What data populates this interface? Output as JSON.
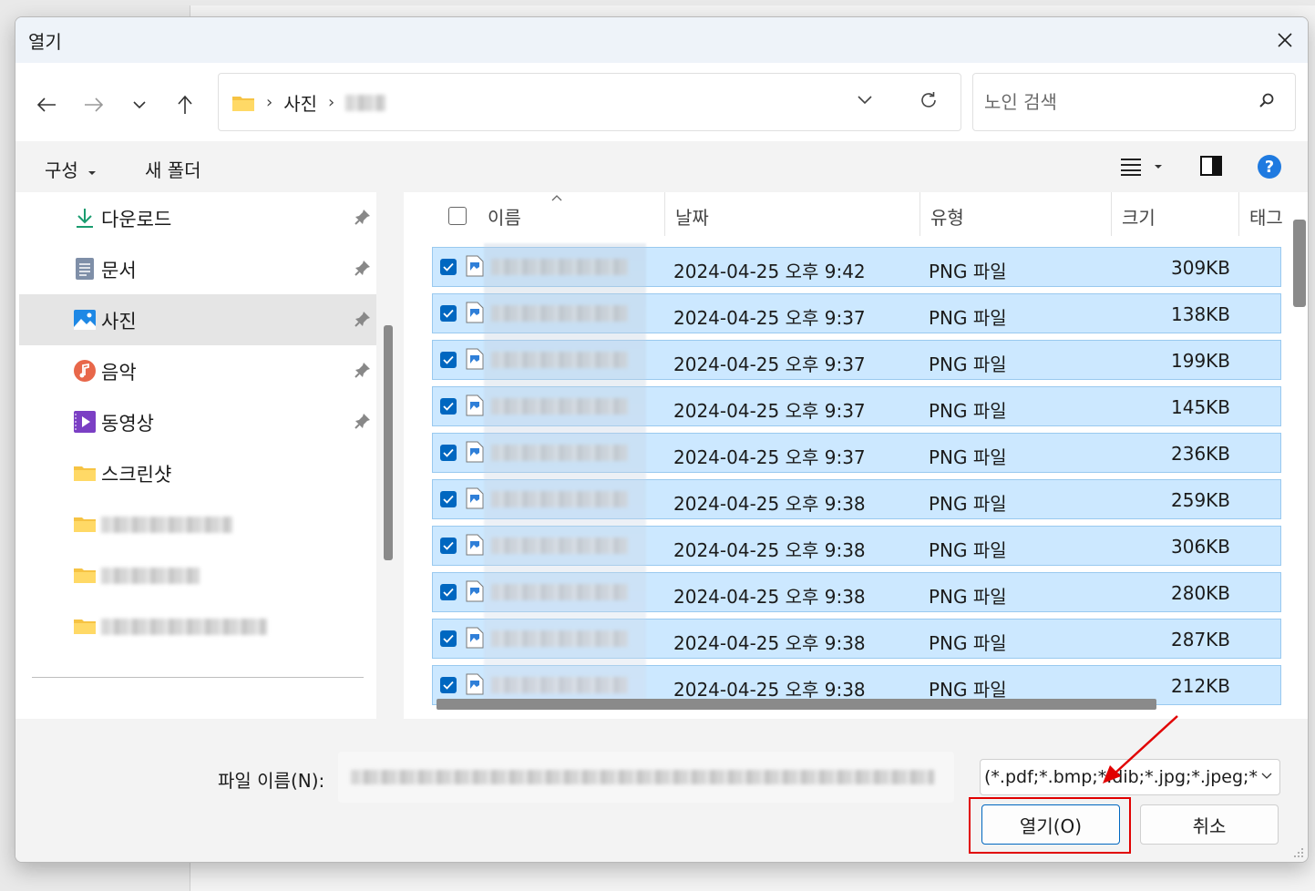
{
  "dialog": {
    "title": "열기"
  },
  "address": {
    "crumbs": [
      "사진"
    ],
    "search_placeholder": "노인 검색"
  },
  "toolbar": {
    "organize": "구성",
    "new_folder": "새 폴더"
  },
  "sidebar": {
    "items": [
      {
        "label": "다운로드",
        "icon": "download-icon",
        "pinned": true
      },
      {
        "label": "문서",
        "icon": "document-icon",
        "pinned": true
      },
      {
        "label": "사진",
        "icon": "pictures-icon",
        "pinned": true,
        "active": true
      },
      {
        "label": "음악",
        "icon": "music-icon",
        "pinned": true
      },
      {
        "label": "동영상",
        "icon": "video-icon",
        "pinned": true
      },
      {
        "label": "스크린샷",
        "icon": "folder-icon",
        "pinned": false
      }
    ]
  },
  "columns": {
    "name": "이름",
    "date": "날짜",
    "type": "유형",
    "size": "크기",
    "tags": "태그"
  },
  "files": [
    {
      "date": "2024-04-25 오후 9:42",
      "type": "PNG 파일",
      "size": "309KB"
    },
    {
      "date": "2024-04-25 오후 9:37",
      "type": "PNG 파일",
      "size": "138KB"
    },
    {
      "date": "2024-04-25 오후 9:37",
      "type": "PNG 파일",
      "size": "199KB"
    },
    {
      "date": "2024-04-25 오후 9:37",
      "type": "PNG 파일",
      "size": "145KB"
    },
    {
      "date": "2024-04-25 오후 9:37",
      "type": "PNG 파일",
      "size": "236KB"
    },
    {
      "date": "2024-04-25 오후 9:38",
      "type": "PNG 파일",
      "size": "259KB"
    },
    {
      "date": "2024-04-25 오후 9:38",
      "type": "PNG 파일",
      "size": "306KB"
    },
    {
      "date": "2024-04-25 오후 9:38",
      "type": "PNG 파일",
      "size": "280KB"
    },
    {
      "date": "2024-04-25 오후 9:38",
      "type": "PNG 파일",
      "size": "287KB"
    },
    {
      "date": "2024-04-25 오후 9:38",
      "type": "PNG 파일",
      "size": "212KB"
    }
  ],
  "bottom": {
    "filename_label": "파일 이름(N):",
    "filter": "(*.pdf;*.bmp;*.dib;*.jpg;*.jpeg;*",
    "open_button": "열기(O)",
    "cancel_button": "취소"
  },
  "colors": {
    "accent": "#0067c0",
    "selection": "#cce8ff",
    "highlight": "#e10000"
  }
}
